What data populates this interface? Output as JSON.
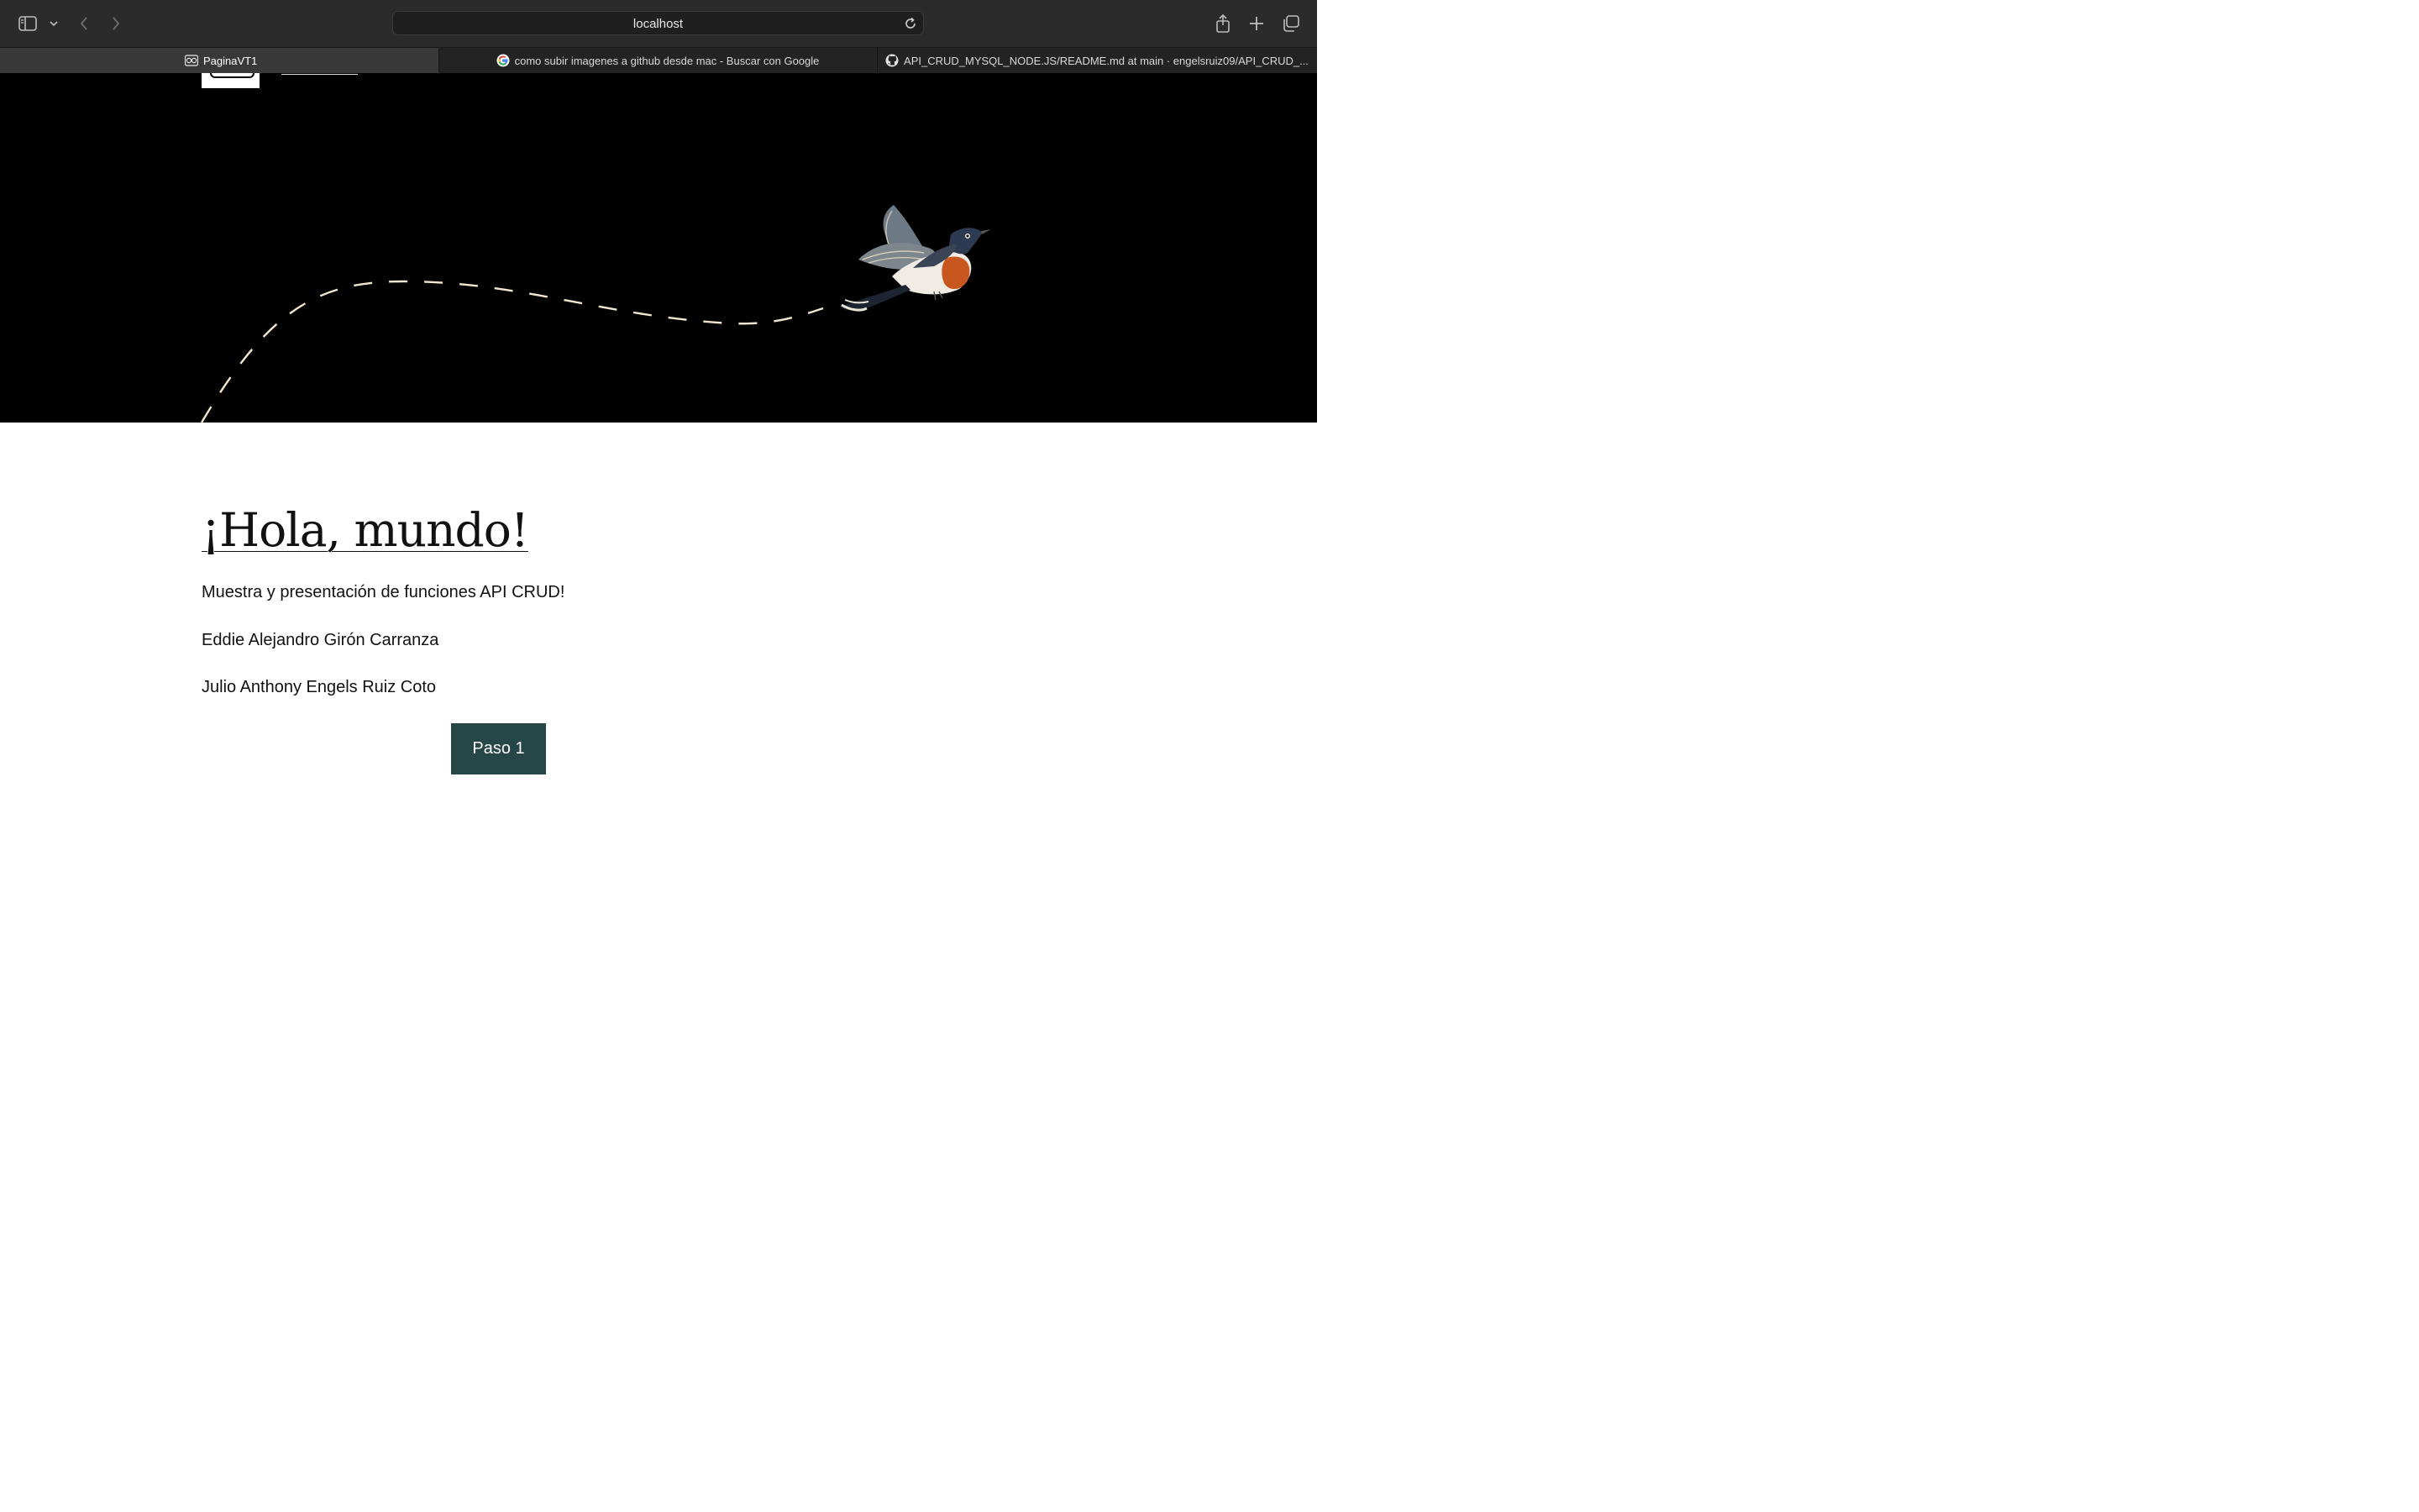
{
  "browser": {
    "url": "localhost",
    "tabs": [
      {
        "title": "PaginaVT1",
        "active": true
      },
      {
        "title": "como subir imagenes a github desde mac - Buscar con Google",
        "active": false
      },
      {
        "title": "API_CRUD_MYSQL_NODE.JS/README.md at main · engelsruiz09/API_CRUD_...",
        "active": false
      }
    ]
  },
  "page": {
    "title": "¡Hola, mundo!",
    "subtitle": "Muestra y presentación de funciones API CRUD!",
    "authors": [
      "Eddie Alejandro Girón Carranza",
      "Julio Anthony Engels Ruiz Coto"
    ],
    "button_label": "Paso 1",
    "button_color": "#274647"
  },
  "colors": {
    "hero_background": "#000000",
    "dash_path": "#f3e6cf"
  }
}
